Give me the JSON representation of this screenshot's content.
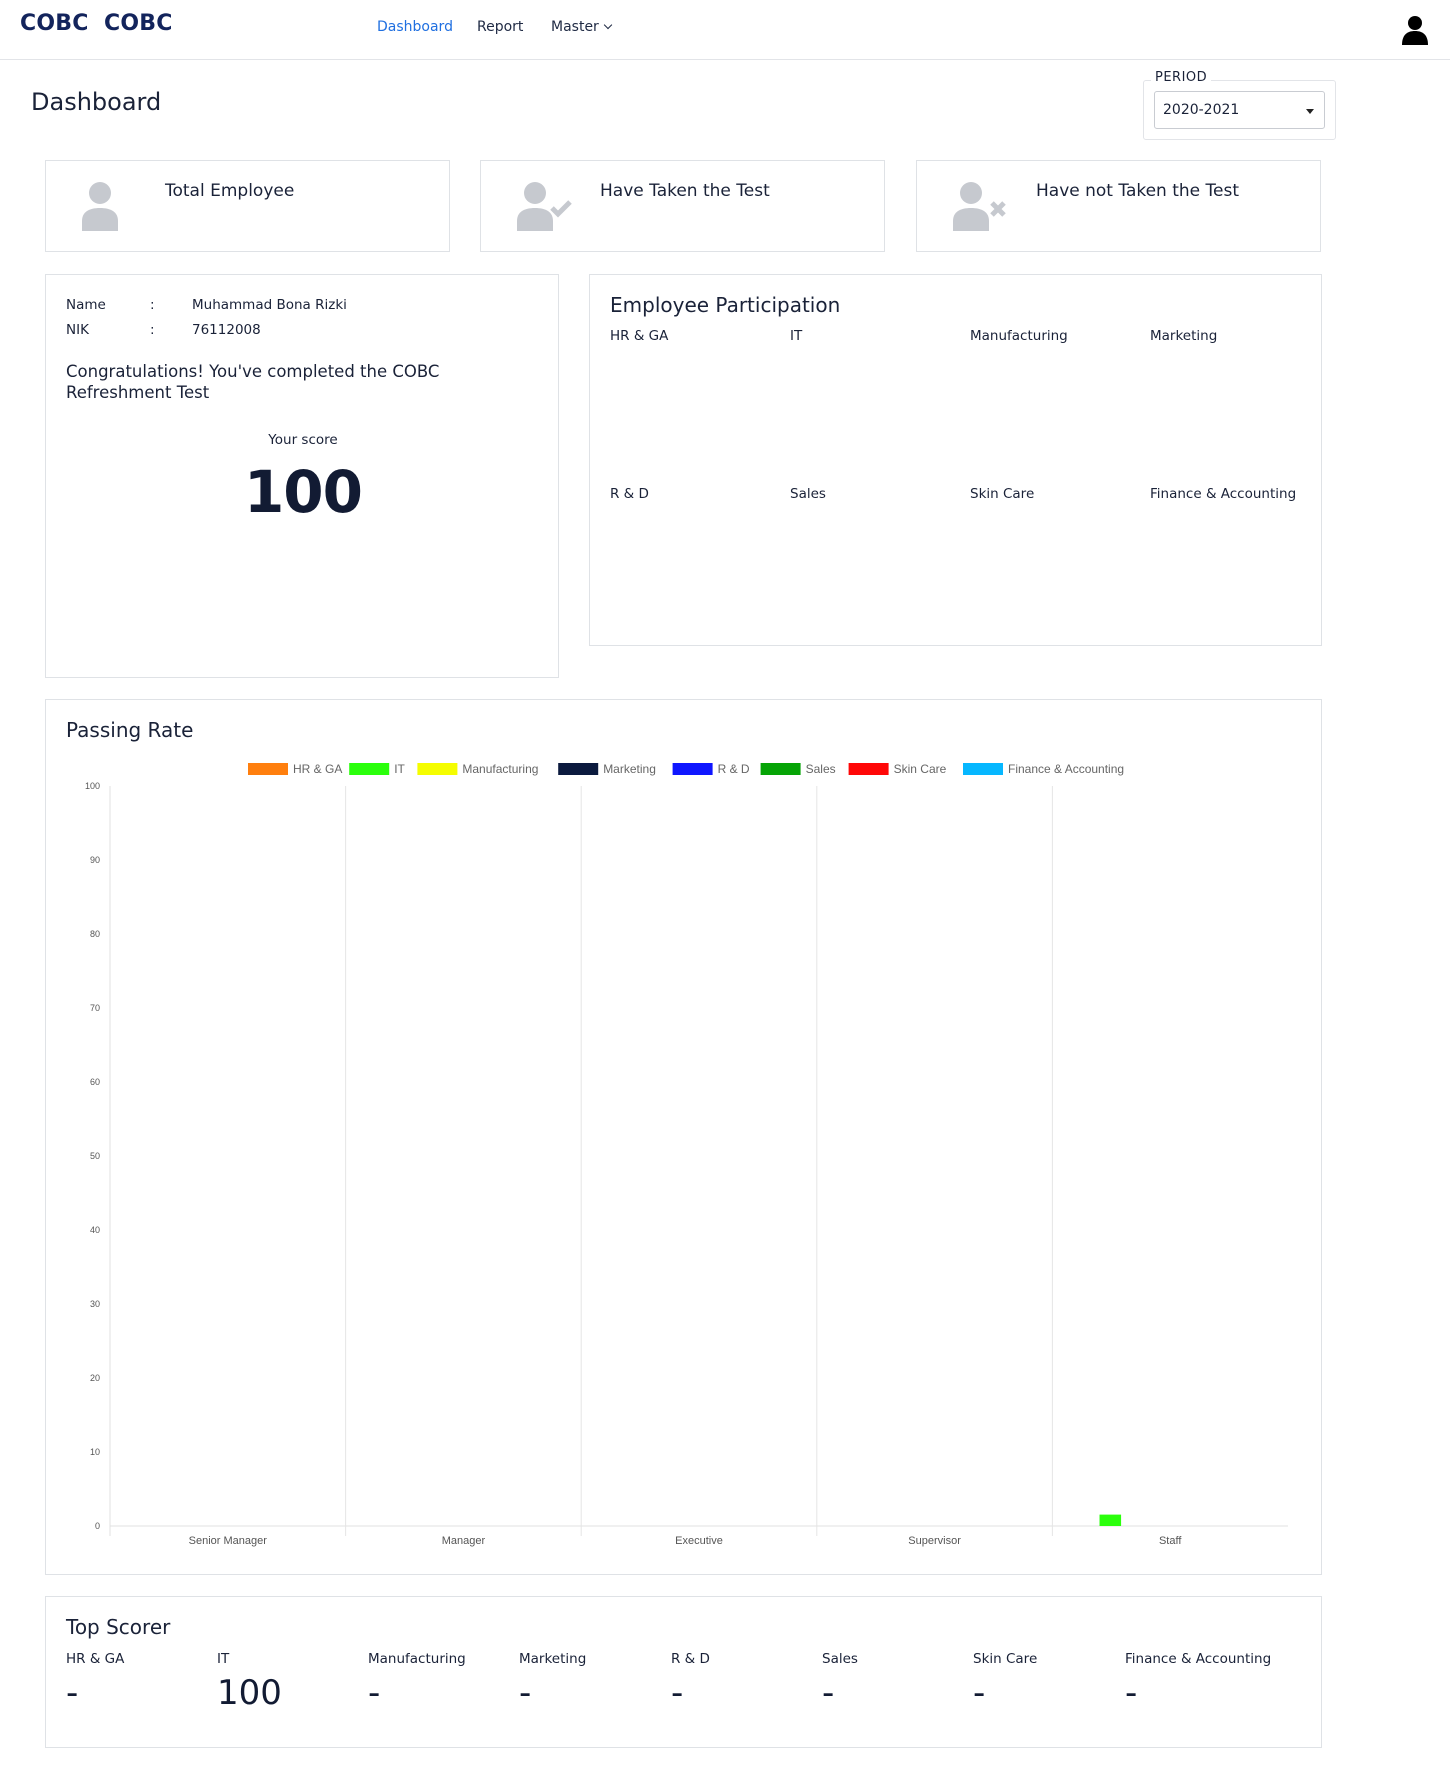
{
  "header": {
    "brand_primary": "COBC",
    "brand_secondary": "COBC",
    "nav": {
      "dashboard": "Dashboard",
      "report": "Report",
      "master": "Master"
    },
    "user_icon": "user-icon"
  },
  "page": {
    "title": "Dashboard",
    "period_label": "PERIOD",
    "period_value": "2020-2021"
  },
  "stats": {
    "total_employee": "Total Employee",
    "taken": "Have Taken the Test",
    "not_taken": "Have not Taken the Test"
  },
  "profile": {
    "name_label": "Name",
    "name_colon": ":",
    "name_value": "Muhammad Bona Rizki",
    "nik_label": "NIK",
    "nik_colon": ":",
    "nik_value": "76112008",
    "message": "Congratulations! You've completed the COBC Refreshment Test",
    "score_label": "Your score",
    "score_value": "100"
  },
  "participation": {
    "title": "Employee Participation",
    "departments": [
      "HR & GA",
      "IT",
      "Manufacturing",
      "Marketing",
      "R & D",
      "Sales",
      "Skin Care",
      "Finance & Accounting"
    ]
  },
  "passing_rate": {
    "title": "Passing Rate"
  },
  "chart_data": {
    "type": "bar",
    "title": "Passing Rate",
    "categories": [
      "Senior Manager",
      "Manager",
      "Executive",
      "Supervisor",
      "Staff"
    ],
    "ylim": [
      0,
      100
    ],
    "yticks": [
      0,
      10,
      20,
      30,
      40,
      50,
      60,
      70,
      80,
      90,
      100
    ],
    "grid": "vertical",
    "legend_position": "top",
    "series": [
      {
        "name": "HR & GA",
        "color": "#ff7f0e",
        "values": [
          0,
          0,
          0,
          0,
          0
        ]
      },
      {
        "name": "IT",
        "color": "#2bff0c",
        "values": [
          0,
          0,
          0,
          0,
          1
        ]
      },
      {
        "name": "Manufacturing",
        "color": "#f5fd00",
        "values": [
          0,
          0,
          0,
          0,
          0
        ]
      },
      {
        "name": "Marketing",
        "color": "#0b1a3e",
        "values": [
          0,
          0,
          0,
          0,
          0
        ]
      },
      {
        "name": "R & D",
        "color": "#0f16ff",
        "values": [
          0,
          0,
          0,
          0,
          0
        ]
      },
      {
        "name": "Sales",
        "color": "#06a406",
        "values": [
          0,
          0,
          0,
          0,
          0
        ]
      },
      {
        "name": "Skin Care",
        "color": "#ff0707",
        "values": [
          0,
          0,
          0,
          0,
          0
        ]
      },
      {
        "name": "Finance & Accounting",
        "color": "#06b7ff",
        "values": [
          0,
          0,
          0,
          0,
          0
        ]
      }
    ]
  },
  "top_scorer": {
    "title": "Top Scorer",
    "items": [
      {
        "dept": "HR & GA",
        "score": "-"
      },
      {
        "dept": "IT",
        "score": "100"
      },
      {
        "dept": "Manufacturing",
        "score": "-"
      },
      {
        "dept": "Marketing",
        "score": "-"
      },
      {
        "dept": "R & D",
        "score": "-"
      },
      {
        "dept": "Sales",
        "score": "-"
      },
      {
        "dept": "Skin Care",
        "score": "-"
      },
      {
        "dept": "Finance & Accounting",
        "score": "-"
      }
    ]
  }
}
